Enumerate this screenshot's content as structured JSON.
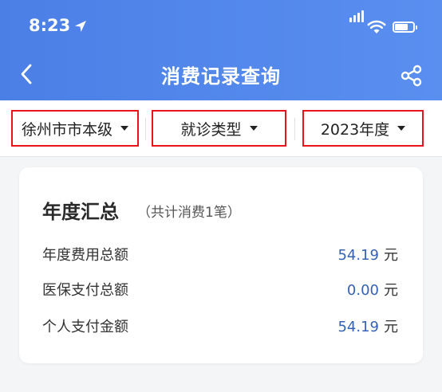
{
  "status_bar": {
    "time": "8:23"
  },
  "header": {
    "title": "消费记录查询"
  },
  "filters": [
    {
      "label": "徐州市市本级"
    },
    {
      "label": "就诊类型"
    },
    {
      "label": "2023年度"
    }
  ],
  "summary": {
    "title": "年度汇总",
    "subtitle": "（共计消费1笔）",
    "rows": [
      {
        "label": "年度费用总额",
        "value": "54.19",
        "unit": "元"
      },
      {
        "label": "医保支付总额",
        "value": "0.00",
        "unit": "元"
      },
      {
        "label": "个人支付金额",
        "value": "54.19",
        "unit": "元"
      }
    ]
  },
  "colors": {
    "header_bg": "#4b7fe6",
    "filter_outline": "#e8131b",
    "amount": "#3462b4"
  }
}
